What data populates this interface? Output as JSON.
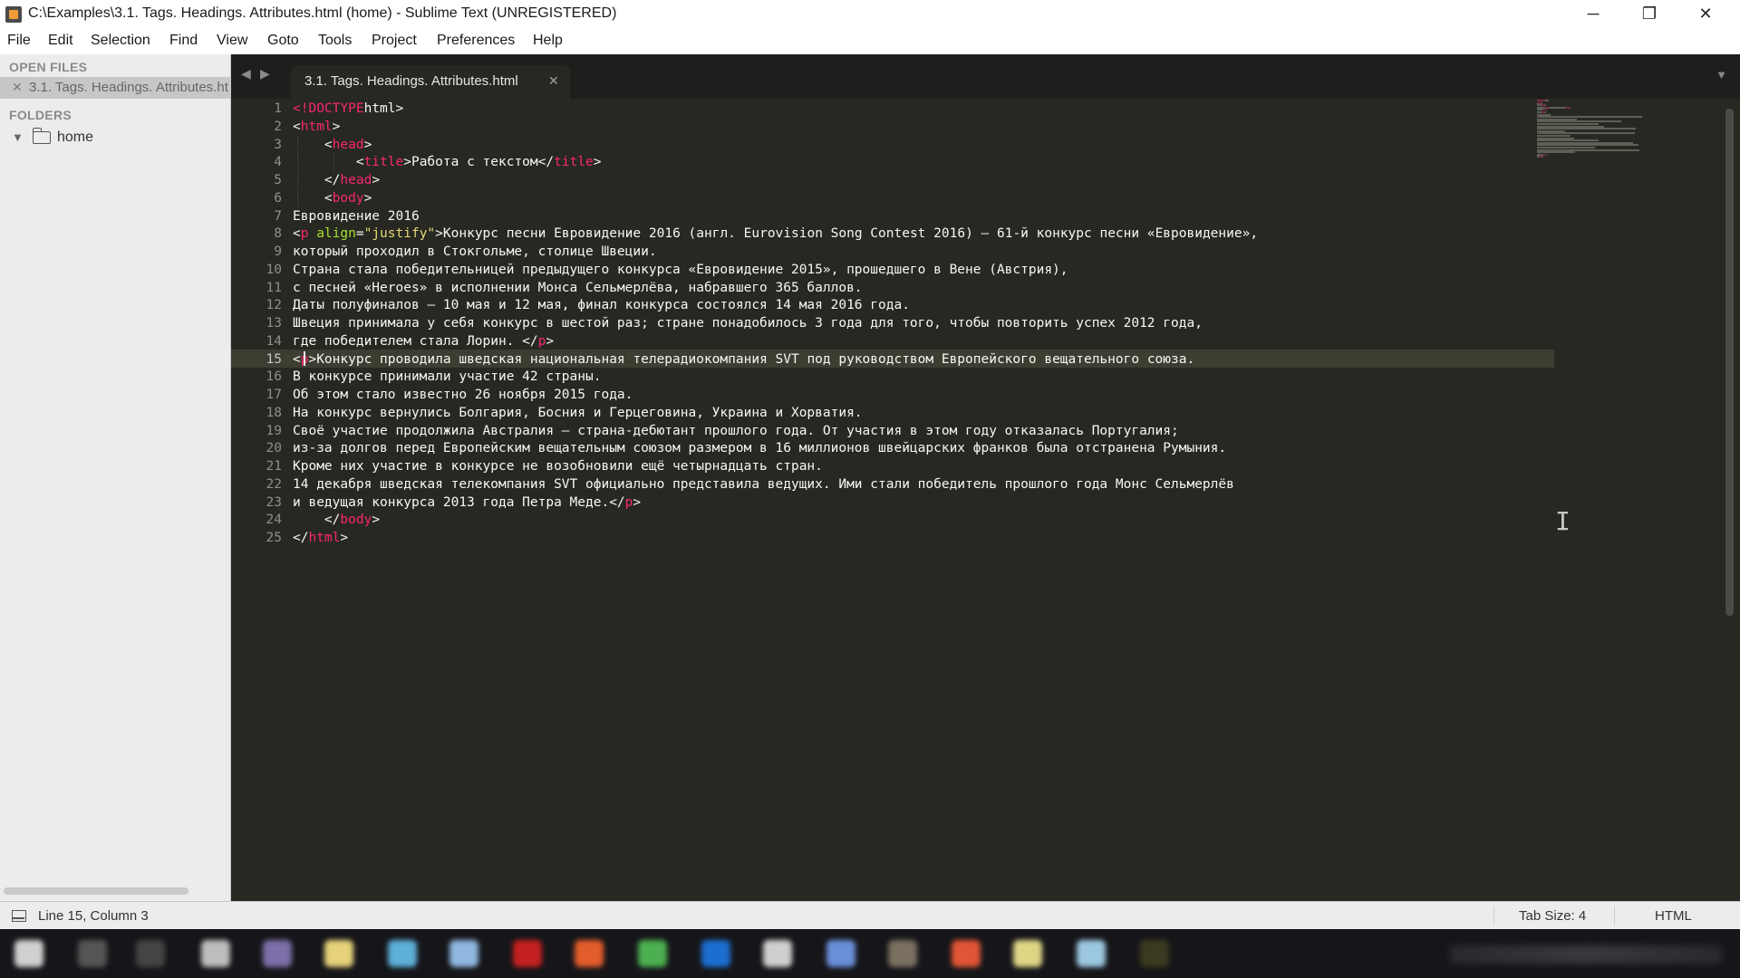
{
  "window": {
    "title": "C:\\Examples\\3.1. Tags. Headings. Attributes.html (home) - Sublime Text (UNREGISTERED)",
    "minimize": "─",
    "maximize": "❐",
    "close": "✕"
  },
  "menu": [
    "File",
    "Edit",
    "Selection",
    "Find",
    "View",
    "Goto",
    "Tools",
    "Project",
    "Preferences",
    "Help"
  ],
  "sidebar": {
    "open_files_label": "OPEN FILES",
    "open_file": "3.1. Tags. Headings. Attributes.html",
    "open_file_close": "✕",
    "folders_label": "FOLDERS",
    "folder": "home",
    "folder_arrow": "▼"
  },
  "tabs": {
    "nav_back": "◀",
    "nav_forward": "▶",
    "active": "3.1. Tags. Headings. Attributes.html",
    "close": "✕",
    "dropdown": "▼"
  },
  "editor": {
    "active_line": 15,
    "lines": [
      [
        [
          "tag",
          "<!"
        ],
        [
          "tag",
          "DOCTYPE"
        ],
        [
          "",
          "html>"
        ]
      ],
      [
        [
          "",
          "<"
        ],
        [
          "tag",
          "html"
        ],
        [
          "",
          ">"
        ]
      ],
      [
        [
          "",
          "    <"
        ],
        [
          "tag",
          "head"
        ],
        [
          "",
          ">"
        ]
      ],
      [
        [
          "",
          "        <"
        ],
        [
          "tag",
          "title"
        ],
        [
          "",
          ">Работа с текстом</"
        ],
        [
          "tag",
          "title"
        ],
        [
          "",
          ">"
        ]
      ],
      [
        [
          "",
          "    </"
        ],
        [
          "tag",
          "head"
        ],
        [
          "",
          ">"
        ]
      ],
      [
        [
          "",
          "    <"
        ],
        [
          "tag",
          "body"
        ],
        [
          "",
          ">"
        ]
      ],
      [
        [
          "",
          "Евровидение 2016"
        ]
      ],
      [
        [
          "",
          "<"
        ],
        [
          "tag",
          "p"
        ],
        [
          "attr",
          " align"
        ],
        [
          "",
          "="
        ],
        [
          "str",
          "\"justify\""
        ],
        [
          "",
          ">Конкурс песни Евровидение 2016 (англ. Eurovision Song Contest 2016) — 61-й конкурс песни «Евровидение»,"
        ]
      ],
      [
        [
          "",
          "который проходил в Стокгольме, столице Швеции."
        ]
      ],
      [
        [
          "",
          "Страна стала победительницей предыдущего конкурса «Евровидение 2015», прошедшего в Вене (Австрия),"
        ]
      ],
      [
        [
          "",
          "с песней «Heroes» в исполнении Монса Сельмерлёва, набравшего 365 баллов."
        ]
      ],
      [
        [
          "",
          "Даты полуфиналов — 10 мая и 12 мая, финал конкурса состоялся 14 мая 2016 года."
        ]
      ],
      [
        [
          "",
          "Швеция принимала у себя конкурс в шестой раз; стране понадобилось 3 года для того, чтобы повторить успех 2012 года,"
        ]
      ],
      [
        [
          "",
          "где победителем стала Лорин. </"
        ],
        [
          "tag",
          "p"
        ],
        [
          "",
          ">"
        ]
      ],
      [
        [
          "",
          "<"
        ],
        [
          "tag",
          "p"
        ],
        [
          "",
          ">Конкурс проводила шведская национальная телерадиокомпания SVT под руководством Европейского вещательного союза."
        ]
      ],
      [
        [
          "",
          "В конкурсе принимали участие 42 страны."
        ]
      ],
      [
        [
          "",
          "Об этом стало известно 26 ноября 2015 года."
        ]
      ],
      [
        [
          "",
          "На конкурс вернулись Болгария, Босния и Герцеговина, Украина и Хорватия."
        ]
      ],
      [
        [
          "",
          "Своё участие продолжила Австралия — страна-дебютант прошлого года. От участия в этом году отказалась Португалия;"
        ]
      ],
      [
        [
          "",
          "из-за долгов перед Европейским вещательным союзом размером в 16 миллионов швейцарских франков была отстранена Румыния."
        ]
      ],
      [
        [
          "",
          "Кроме них участие в конкурсе не возобновили ещё четырнадцать стран."
        ]
      ],
      [
        [
          "",
          "14 декабря шведская телекомпания SVT официально представила ведущих. Ими стали победитель прошлого года Монс Сельмерлёв"
        ]
      ],
      [
        [
          "",
          "и ведущая конкурса 2013 года Петра Меде.</"
        ],
        [
          "tag",
          "p"
        ],
        [
          "",
          ">"
        ]
      ],
      [
        [
          "",
          "    </"
        ],
        [
          "tag",
          "body"
        ],
        [
          "",
          ">"
        ]
      ],
      [
        [
          "",
          "</"
        ],
        [
          "tag",
          "html"
        ],
        [
          "",
          ">"
        ]
      ]
    ]
  },
  "statusbar": {
    "position": "Line 15, Column 3",
    "tab_size": "Tab Size: 4",
    "syntax": "HTML"
  },
  "colors": {
    "editor_bg": "#272822",
    "tag": "#f92672",
    "attribute": "#a6e22e",
    "string": "#e6db74",
    "text": "#f8f8f2"
  }
}
